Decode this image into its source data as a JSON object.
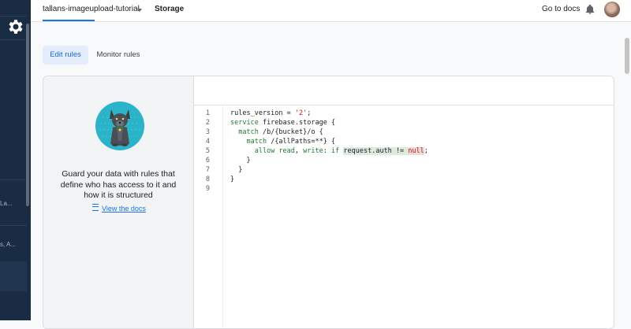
{
  "sidebar": {
    "truncated_items": [
      {
        "text": "La..."
      },
      {
        "text": "s, A..."
      }
    ]
  },
  "header": {
    "project_name": "tallans-imageupload-tutorial",
    "breadcrumb": "Storage",
    "docs_link": "Go to docs"
  },
  "tabs": [
    {
      "label": "Edit rules",
      "active": true
    },
    {
      "label": "Monitor rules",
      "active": false
    }
  ],
  "left_panel": {
    "message": "Guard your data with rules that define who has access to it and how it is structured",
    "link": "View the docs"
  },
  "editor": {
    "line_numbers": [
      "1",
      "2",
      "3",
      "4",
      "5",
      "6",
      "7",
      "8",
      "9"
    ],
    "lines": [
      "rules_version = '2';",
      "service firebase.storage {",
      "  match /b/{bucket}/o {",
      "    match /{allPaths=**} {",
      "      allow read, write: if request.auth != null;",
      "    }",
      "  }",
      "}",
      ""
    ]
  },
  "colors": {
    "sidebar_bg": "#1a2b44",
    "accent": "#1a73e8",
    "keyword": "#1e7b34",
    "string": "#c41a16"
  },
  "icons": [
    "gear-icon",
    "chevron-down-icon",
    "bell-icon",
    "avatar",
    "mascot-dog",
    "docs-icon"
  ]
}
